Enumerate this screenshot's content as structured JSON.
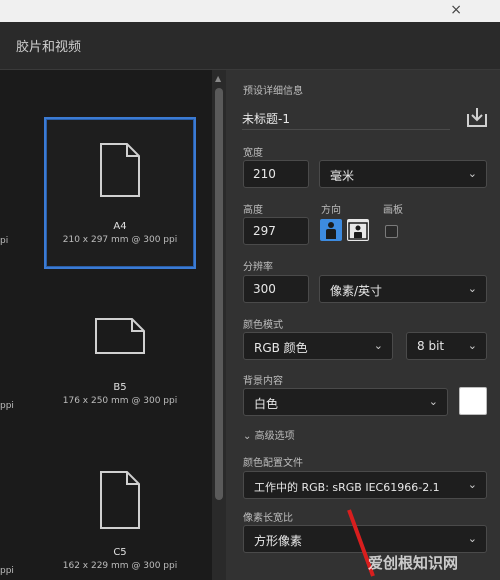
{
  "window": {
    "close_glyph": "×"
  },
  "tabs": {
    "active_label": "胶片和视频"
  },
  "presets": [
    {
      "name": "A4",
      "dims": "210 x 297 mm @ 300 ppi",
      "selected": true,
      "icon": "portrait-document-icon"
    },
    {
      "name": "B5",
      "dims": "176 x 250 mm @ 300 ppi",
      "selected": false,
      "icon": "landscape-document-icon"
    },
    {
      "name": "C5",
      "dims": "162 x 229 mm @ 300 ppi",
      "selected": false,
      "icon": "portrait-document-icon"
    }
  ],
  "left_fragments": [
    "pi",
    "ppi",
    "ppi"
  ],
  "details": {
    "section_label": "预设详细信息",
    "doc_title": "未标题-1",
    "width_label": "宽度",
    "width_value": "210",
    "width_unit": "毫米",
    "height_label": "高度",
    "height_value": "297",
    "orientation_label": "方向",
    "artboard_label": "画板",
    "resolution_label": "分辨率",
    "resolution_value": "300",
    "resolution_unit": "像素/英寸",
    "color_mode_label": "颜色模式",
    "color_mode_value": "RGB 颜色",
    "bit_depth_value": "8 bit",
    "background_label": "背景内容",
    "background_value": "白色",
    "advanced_label": "高级选项",
    "color_profile_label": "颜色配置文件",
    "color_profile_value": "工作中的 RGB: sRGB IEC61966-2.1",
    "pixel_aspect_label": "像素长宽比",
    "pixel_aspect_value": "方形像素"
  },
  "watermark": "爱创根知识网",
  "colors": {
    "accent": "#3b7bd4",
    "panel": "#323232",
    "field": "#1e1e1e"
  }
}
